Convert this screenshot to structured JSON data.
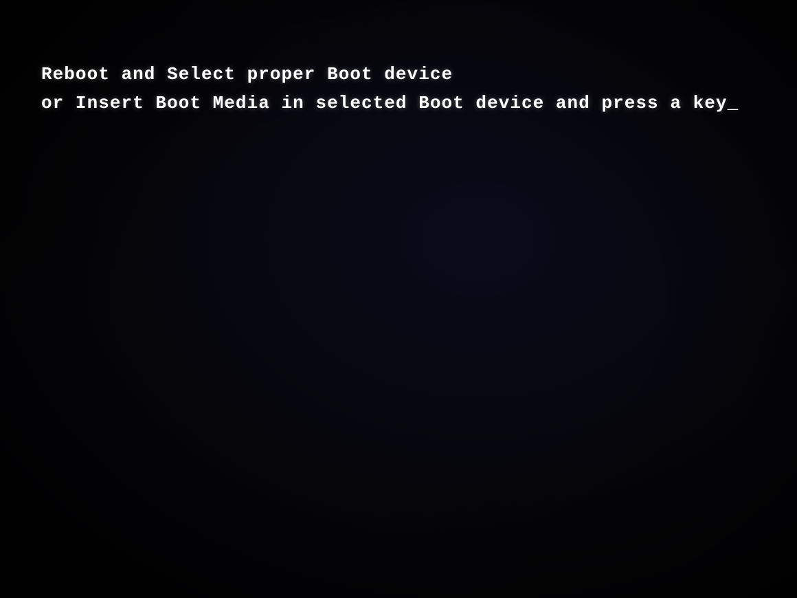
{
  "screen": {
    "background_color": "#000000",
    "boot_message": {
      "line1": "Reboot and Select proper Boot device",
      "line2_prefix": "or Insert Boot Media in selected Boot device and press a key",
      "line2_cursor": "_"
    }
  }
}
